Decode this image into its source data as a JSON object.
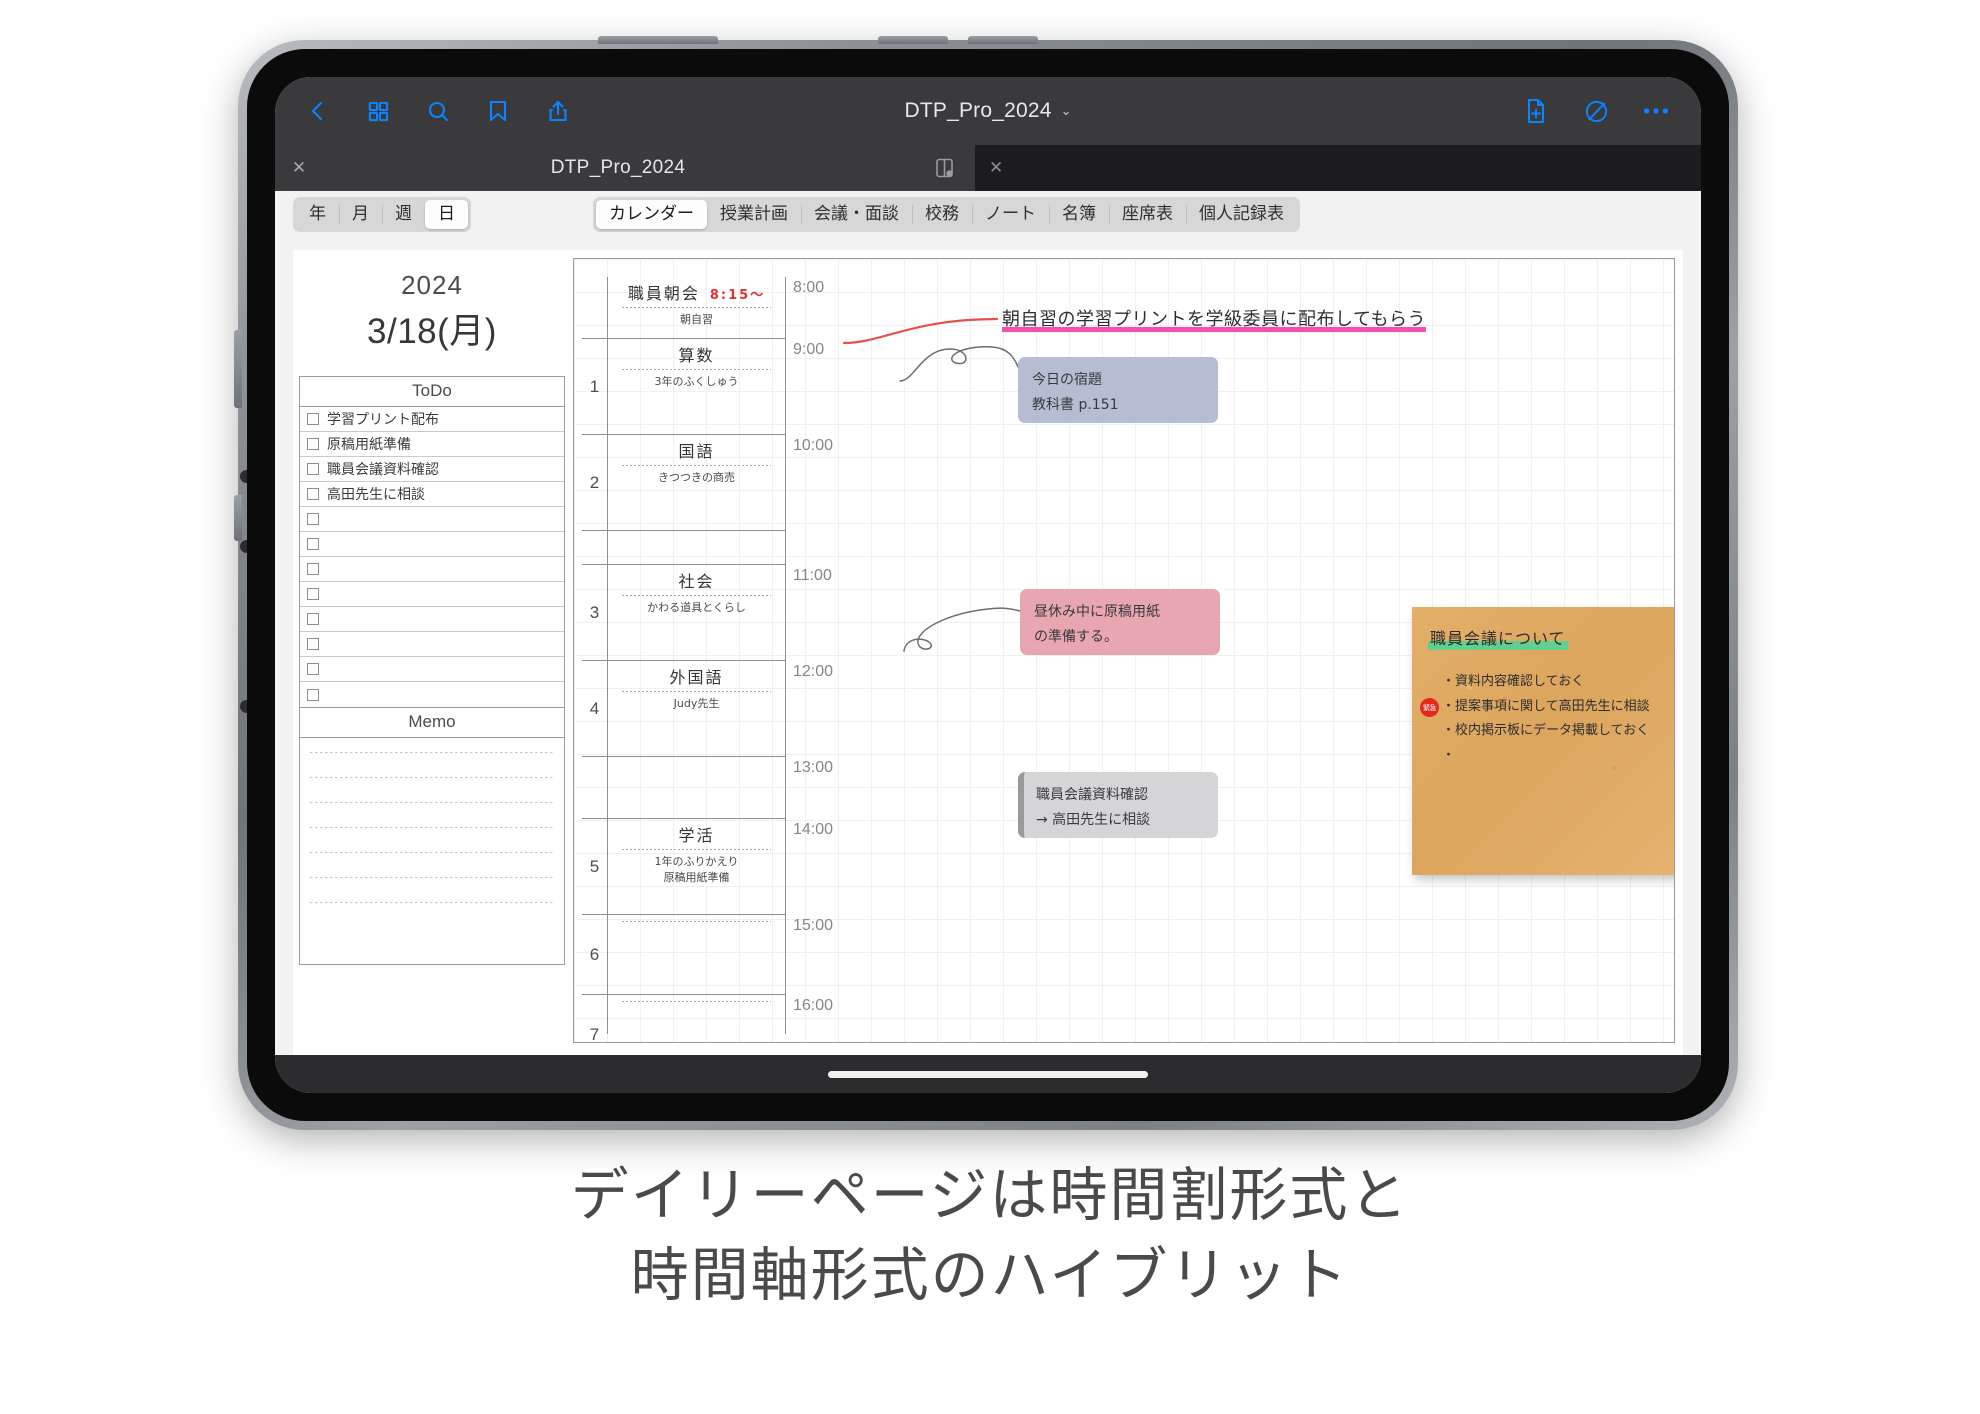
{
  "toolbar": {
    "back_icon": "chevron-left-icon",
    "thumbnails_icon": "grid-icon",
    "search_icon": "search-icon",
    "bookmark_icon": "bookmark-icon",
    "share_icon": "share-icon",
    "add_page_icon": "add-page-icon",
    "edit_icon": "pen-circle-icon",
    "more_icon": "more-icon",
    "doc_title": "DTP_Pro_2024",
    "chevron": "⌄"
  },
  "tabstrip": {
    "tab_label": "DTP_Pro_2024",
    "close_label": "✕",
    "split_icon": "split-view-icon",
    "empty_close_label": "✕"
  },
  "segments": {
    "period": [
      {
        "label": "年",
        "active": false
      },
      {
        "label": "月",
        "active": false
      },
      {
        "label": "週",
        "active": false
      },
      {
        "label": "日",
        "active": true
      }
    ],
    "sections": [
      {
        "label": "カレンダー",
        "active": true
      },
      {
        "label": "授業計画",
        "active": false
      },
      {
        "label": "会議・面談",
        "active": false
      },
      {
        "label": "校務",
        "active": false
      },
      {
        "label": "ノート",
        "active": false
      },
      {
        "label": "名簿",
        "active": false
      },
      {
        "label": "座席表",
        "active": false
      },
      {
        "label": "個人記録表",
        "active": false
      }
    ]
  },
  "page": {
    "year": "2024",
    "date": "3/18(月)",
    "todo_heading": "ToDo",
    "todos": [
      {
        "text": "学習プリント配布"
      },
      {
        "text": "原稿用紙準備"
      },
      {
        "text": "職員会議資料確認"
      },
      {
        "text": "高田先生に相談"
      },
      {
        "text": ""
      },
      {
        "text": ""
      },
      {
        "text": ""
      },
      {
        "text": ""
      },
      {
        "text": ""
      },
      {
        "text": ""
      },
      {
        "text": ""
      },
      {
        "text": ""
      }
    ],
    "memo_heading": "Memo",
    "memo_lines": 7
  },
  "schedule": {
    "rows": [
      {
        "num": "",
        "subject": "職員朝会",
        "subject_time": "8:15〜",
        "sub": "朝自習",
        "time": "8:00",
        "dotted": true
      },
      {
        "num": "1",
        "subject": "算数",
        "subject_time": "",
        "sub": "3年のふくしゅう",
        "time": "9:00",
        "dotted": true
      },
      {
        "num": "2",
        "subject": "国語",
        "subject_time": "",
        "sub": "きつつきの商売",
        "time": "10:00",
        "dotted": true
      },
      {
        "num": "",
        "subject": "",
        "subject_time": "",
        "sub": "",
        "time": "",
        "dotted": false
      },
      {
        "num": "3",
        "subject": "社会",
        "subject_time": "",
        "sub": "かわる道具とくらし",
        "time": "11:00",
        "dotted": true
      },
      {
        "num": "4",
        "subject": "外国語",
        "subject_time": "",
        "sub": "Judy先生",
        "time": "12:00",
        "dotted": true
      },
      {
        "num": "",
        "subject": "",
        "subject_time": "",
        "sub": "",
        "time": "13:00",
        "dotted": false
      },
      {
        "num": "5",
        "subject": "学活",
        "subject_time": "",
        "sub": "1年のふりかえり\n原稿用紙準備",
        "time": "14:00",
        "dotted": true
      },
      {
        "num": "6",
        "subject": "",
        "subject_time": "",
        "sub": "",
        "time": "15:00",
        "dotted": true
      },
      {
        "num": "7",
        "subject": "",
        "subject_time": "",
        "sub": "",
        "time": "16:00",
        "dotted": true
      },
      {
        "num": "",
        "subject": "",
        "subject_time": "",
        "sub": "",
        "time": "",
        "dotted": false
      }
    ],
    "notes": {
      "handwritten_red": "朝自習の学習プリントを学級委員に配布してもらう",
      "blue": {
        "line1": "今日の宿題",
        "line2": "教科書 p.151",
        "color": "#b4bdd2"
      },
      "pink": {
        "line1": "昼休み中に原稿用紙",
        "line2": "の準備する。",
        "color": "#e8a7b0"
      },
      "gray": {
        "line1": "職員会議資料確認",
        "line2": "→ 高田先生に相談",
        "color": "#d5d5d7"
      }
    },
    "kraft": {
      "title": "職員会議について",
      "highlight_color": "#63cf8e",
      "badge": "緊急",
      "badge_color": "#e02a1e",
      "bullets": [
        "・資料内容確認しておく",
        "・提案事項に関して高田先生に相談",
        "・校内掲示板にデータ掲載しておく",
        "・"
      ]
    }
  },
  "caption": {
    "line1": "デイリーページは時間割形式と",
    "line2": "時間軸形式のハイブリット"
  }
}
